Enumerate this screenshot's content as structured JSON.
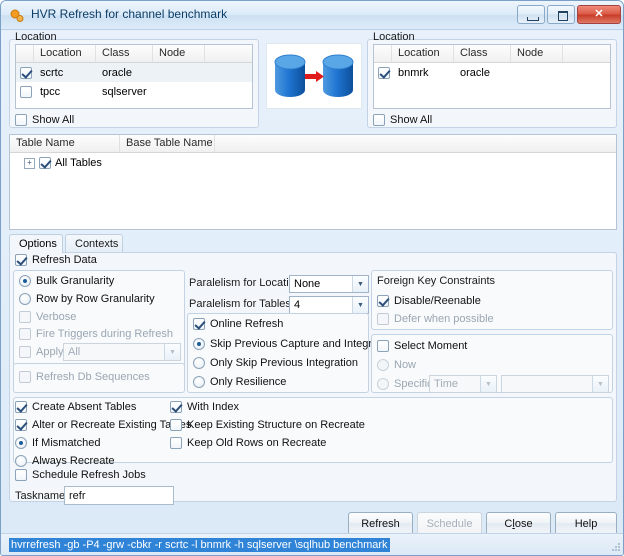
{
  "window": {
    "title": "HVR Refresh for channel benchmark",
    "icon": "hvr-app-icon",
    "controls": {
      "minimize": "Minimize",
      "maximize": "Maximize",
      "close": "Close"
    }
  },
  "source": {
    "group_label": "Location",
    "columns": [
      "Location",
      "Class",
      "Node"
    ],
    "rows": [
      {
        "checked": true,
        "selected": true,
        "location": "scrtc",
        "class": "oracle",
        "node": ""
      },
      {
        "checked": false,
        "selected": false,
        "location": "tpcc",
        "class": "sqlserver",
        "node": ""
      }
    ],
    "show_all": {
      "label": "Show All",
      "checked": false
    }
  },
  "target": {
    "group_label": "Location",
    "columns": [
      "Location",
      "Class",
      "Node"
    ],
    "rows": [
      {
        "checked": true,
        "selected": false,
        "location": "bnmrk",
        "class": "oracle",
        "node": ""
      }
    ],
    "show_all": {
      "label": "Show All",
      "checked": false
    }
  },
  "transfer_icon": "database-to-database-arrow-icon",
  "tables": {
    "columns": [
      "Table Name",
      "Base Table Name"
    ],
    "rows": [
      {
        "expander": "+",
        "checked": true,
        "name": "All Tables",
        "base_name": ""
      }
    ]
  },
  "tabs": [
    {
      "label": "Options",
      "active": true
    },
    {
      "label": "Contexts",
      "active": false
    }
  ],
  "options": {
    "refresh_data": {
      "label": "Refresh Data",
      "checked": true
    },
    "granularity": {
      "bulk": {
        "label": "Bulk Granularity",
        "checked": true
      },
      "row_by_row": {
        "label": "Row by Row Granularity",
        "checked": false
      },
      "verbose": {
        "label": "Verbose",
        "checked": false,
        "disabled": true
      },
      "fire_triggers": {
        "label": "Fire Triggers during Refresh",
        "checked": false,
        "disabled": true
      },
      "apply": {
        "label": "Apply",
        "checked": false,
        "disabled": true,
        "value": "All"
      }
    },
    "refresh_db_sequences": {
      "label": "Refresh Db Sequences",
      "checked": false,
      "disabled": true
    },
    "parallelism_locations": {
      "label": "Paralelism for Locations",
      "value": "None"
    },
    "parallelism_tables": {
      "label": "Paralelism for Tables",
      "value": "4"
    },
    "online_refresh": {
      "label": "Online Refresh",
      "checked": true
    },
    "online_mode": {
      "skip_capture_integration": {
        "label": "Skip Previous Capture and Integration",
        "checked": true
      },
      "only_skip_integration": {
        "label": "Only Skip Previous Integration",
        "checked": false
      },
      "only_resilience": {
        "label": "Only Resilience",
        "checked": false
      }
    },
    "foreign_key": {
      "title": "Foreign Key Constraints",
      "disable_reenable": {
        "label": "Disable/Reenable",
        "checked": true
      },
      "defer_when_possible": {
        "label": "Defer when possible",
        "checked": false,
        "disabled": true
      }
    },
    "select_moment": {
      "label": "Select Moment",
      "checked": false,
      "now": {
        "label": "Now",
        "checked": false,
        "disabled": true
      },
      "specific": {
        "label": "Specific",
        "checked": false,
        "disabled": true,
        "type_value": "Time",
        "value": ""
      }
    },
    "create_absent_tables": {
      "label": "Create Absent Tables",
      "checked": true
    },
    "alter_or_recreate": {
      "label": "Alter or Recreate Existing Tables",
      "checked": true
    },
    "if_mismatched": {
      "label": "If Mismatched",
      "checked": true
    },
    "always_recreate": {
      "label": "Always Recreate",
      "checked": false
    },
    "with_index": {
      "label": "With Index",
      "checked": true
    },
    "keep_existing_structure": {
      "label": "Keep Existing Structure on Recreate",
      "checked": false
    },
    "keep_old_rows": {
      "label": "Keep Old Rows on Recreate",
      "checked": false
    },
    "schedule_refresh_jobs": {
      "label": "Schedule Refresh Jobs",
      "checked": false
    },
    "taskname": {
      "label": "Taskname",
      "value": "refr"
    }
  },
  "buttons": {
    "refresh": "Refresh",
    "schedule": "Schedule",
    "close_pre": "C",
    "close_accel": "l",
    "close_post": "ose",
    "help": "Help"
  },
  "statusbar": {
    "command": "hvrrefresh -gb -P4 -grw -cbkr -r scrtc -l bnmrk -h sqlserver \\sqlhub benchmark"
  }
}
